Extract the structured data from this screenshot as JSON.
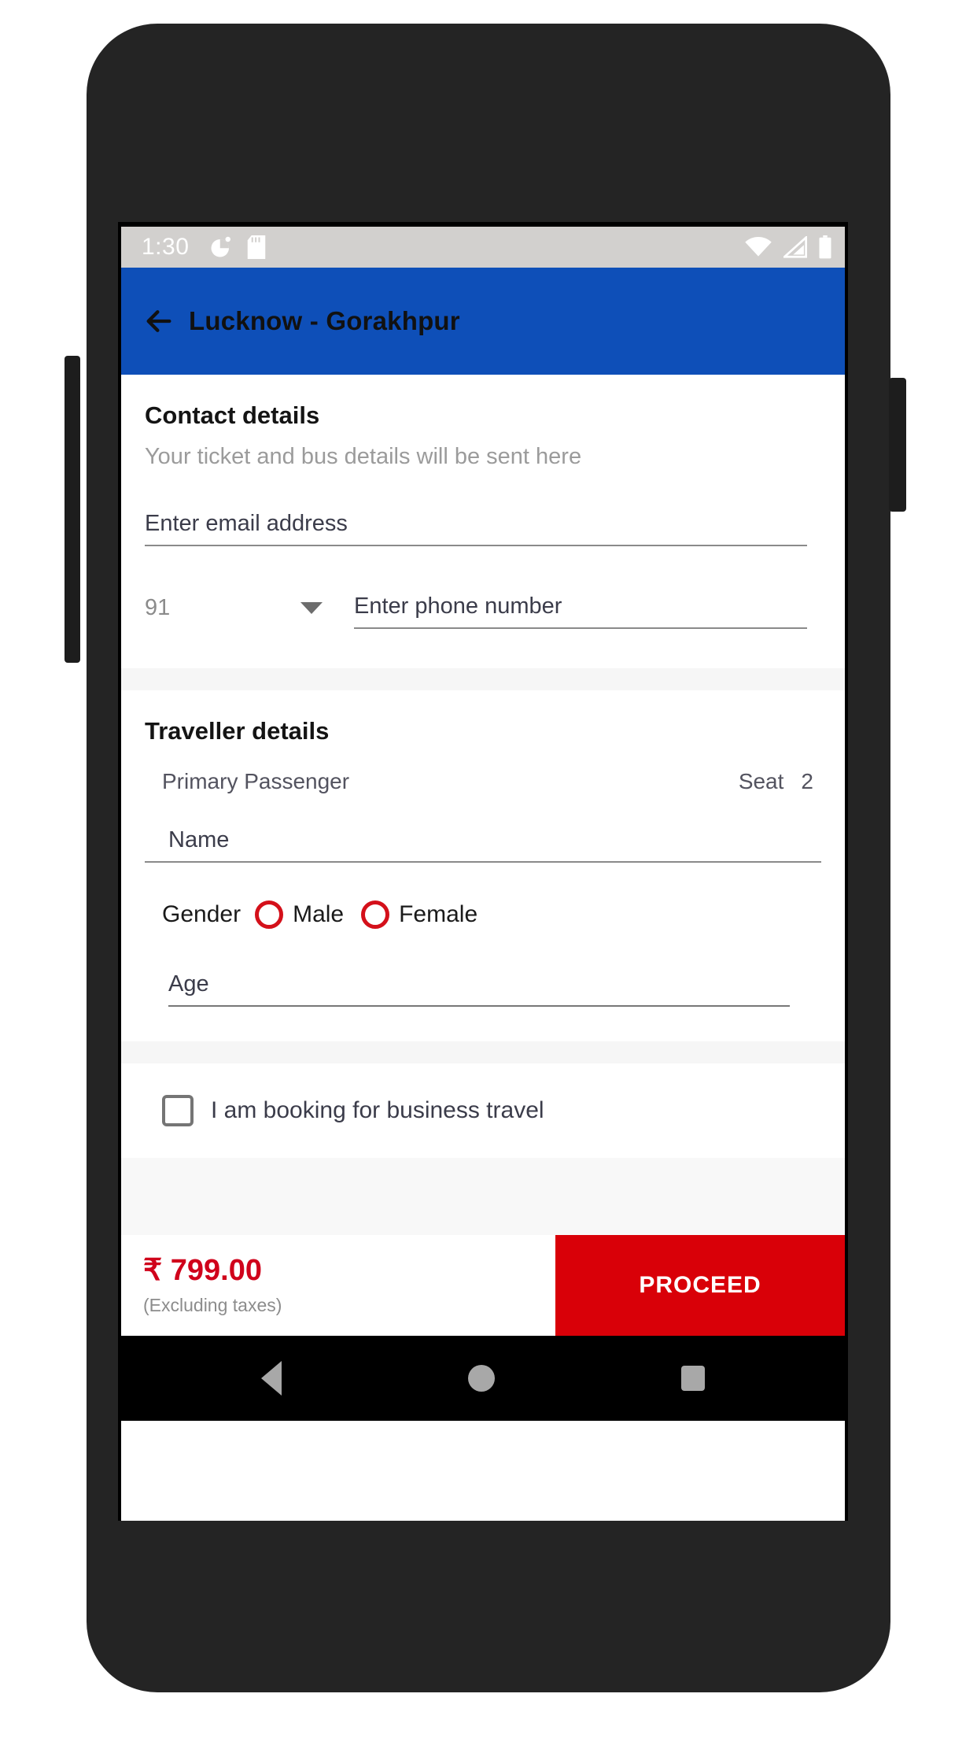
{
  "status_bar": {
    "time": "1:30",
    "left_icons": [
      "alarm-icon",
      "sd-card-icon"
    ],
    "right_icons": [
      "wifi-icon",
      "cellular-signal-icon",
      "battery-icon"
    ],
    "background": "#d2d0ce"
  },
  "app_bar": {
    "back_label": "back-arrow",
    "title": "Lucknow - Gorakhpur",
    "background": "#0e4fb8"
  },
  "contact": {
    "title": "Contact details",
    "subtitle": "Your ticket and bus details will be sent here",
    "email": {
      "value": "",
      "placeholder": "Enter email address"
    },
    "country_code": {
      "value": "91",
      "options": [
        "91"
      ]
    },
    "phone": {
      "value": "",
      "placeholder": "Enter phone number"
    }
  },
  "traveller": {
    "title": "Traveller details",
    "passenger_label": "Primary Passenger",
    "seat_label": "Seat",
    "seat_number": "2",
    "name": {
      "value": "",
      "placeholder": "Name"
    },
    "gender": {
      "label": "Gender",
      "options": [
        "Male",
        "Female"
      ],
      "selected": "",
      "accent": "#d4101a"
    },
    "age": {
      "value": "",
      "placeholder": "Age"
    }
  },
  "business": {
    "checkbox_label": "I am booking for business travel",
    "checked": false
  },
  "footer": {
    "price": "₹ 799.00",
    "price_note": "(Excluding taxes)",
    "price_color": "#d0021b",
    "proceed_label": "PROCEED",
    "proceed_color": "#d90008"
  },
  "nav_bar": {
    "items": [
      "back-nav-icon",
      "home-nav-icon",
      "recents-nav-icon"
    ]
  }
}
